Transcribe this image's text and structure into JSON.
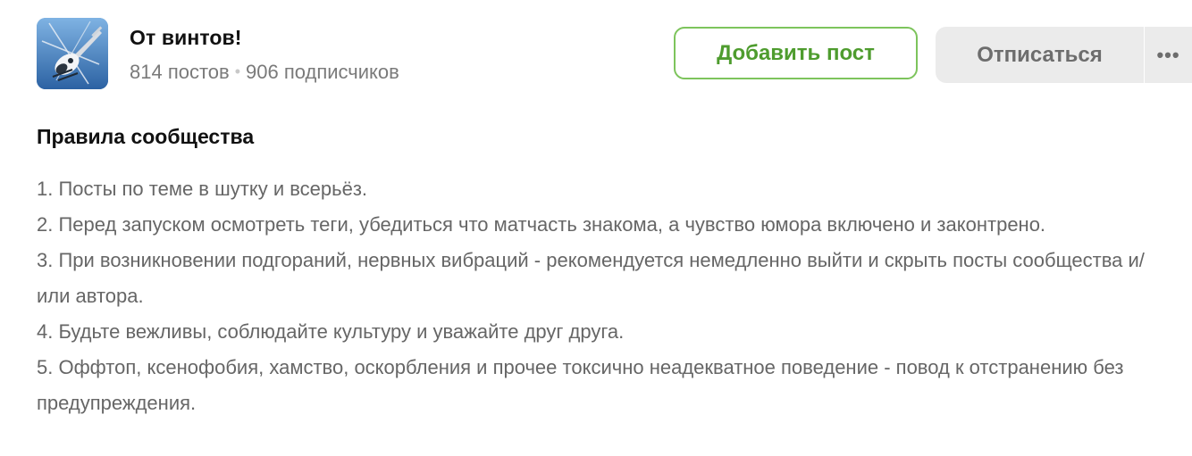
{
  "community": {
    "name": "От винтов!",
    "posts": "814 постов",
    "subscribers": "906 подписчиков",
    "separator": "•"
  },
  "actions": {
    "add_post_label": "Добавить пост",
    "unsubscribe_label": "Отписаться",
    "more_label": "•••"
  },
  "rules": {
    "heading": "Правила сообщества",
    "items": [
      "1. Посты по теме в шутку и всерьёз.",
      "2. Перед запуском осмотреть теги, убедиться что матчасть знакома, а чувство юмора включено и законтрено.",
      "3. При возникновении подгораний, нервных вибраций - рекомендуется немедленно выйти и скрыть посты сообщества и/или автора.",
      "4. Будьте вежливы, соблюдайте культуру и уважайте друг друга.",
      "5. Оффтоп, ксенофобия, хамство, оскорбления и прочее токсично неадекватное поведение - повод к отстранению без предупреждения."
    ]
  },
  "colors": {
    "accent_green": "#4e9c2e",
    "button_gray": "#ebebeb",
    "text_muted": "#666666"
  },
  "icons": {
    "avatar": "helicopter-image",
    "more": "more-dots-icon"
  }
}
